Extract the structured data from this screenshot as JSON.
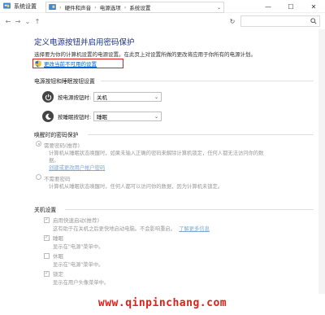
{
  "window": {
    "title": "系统设置",
    "controls": {
      "minimize": "—",
      "maximize": "☐",
      "close": "✕"
    }
  },
  "address": {
    "root_icon": "control-panel-icon",
    "crumbs": [
      "硬件和声音",
      "电源选项",
      "系统设置"
    ]
  },
  "main": {
    "title": "定义电源按钮并启用密码保护",
    "description": "选择要为你的计算机设置的电源设置。在此页上对设置所做的更改将应用于你所有的电源计划。",
    "change_link": "更改当前不可用的设置",
    "power_section": {
      "heading": "电源按钮和睡眠按钮设置",
      "power_button_label": "按电源按钮时:",
      "power_button_value": "关机",
      "sleep_button_label": "按睡眠按钮时:",
      "sleep_button_value": "睡眠"
    },
    "wake_section": {
      "heading": "唤醒时的密码保护",
      "option1_label": "需要密码(推荐)",
      "option1_desc": "计算机从睡眠状态唤醒时，如果未输入正确的密码来解除计算机锁定，任何人都无法访问你的数据。",
      "option1_link": "创建或更改用户帐户密码",
      "option2_label": "不需要密码",
      "option2_desc": "计算机从睡眠状态唤醒时，任何人都可以访问你的数据，因为计算机未锁定。"
    },
    "shutdown_section": {
      "heading": "关机设置",
      "items": [
        {
          "label": "启用快速启动(推荐)",
          "checked": true,
          "desc": "这有助于在关机之后更快地启动电脑。不会影响重启。",
          "link": "了解更多信息"
        },
        {
          "label": "睡眠",
          "checked": true,
          "desc": "显示在\"电源\"菜单中。"
        },
        {
          "label": "休眠",
          "checked": false,
          "desc": "显示在\"电源\"菜单中。"
        },
        {
          "label": "锁定",
          "checked": true,
          "desc": "显示在用户头像菜单中。"
        }
      ]
    }
  },
  "watermark": "www.qinpinchang.com",
  "colors": {
    "title_blue": "#1e3287",
    "link_blue": "#0066cc",
    "highlight_red": "#e0201a"
  }
}
